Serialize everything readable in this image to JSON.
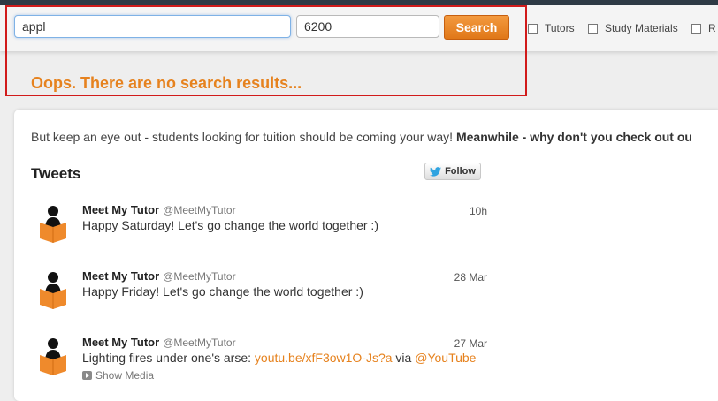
{
  "search": {
    "query_value": "appl",
    "postcode_value": "6200",
    "button_label": "Search",
    "filters": [
      {
        "label": "Tutors",
        "checked": false
      },
      {
        "label": "Study Materials",
        "checked": false
      },
      {
        "label": "R",
        "checked": false
      }
    ],
    "no_results": "Oops. There are no search results..."
  },
  "intro": {
    "text": "But keep an eye out - students looking for tuition should be coming your way! ",
    "bold": "Meanwhile - why don't you check out ou"
  },
  "tweets": {
    "title": "Tweets",
    "follow_label": "Follow",
    "items": [
      {
        "name": "Meet My Tutor",
        "handle": "@MeetMyTutor",
        "time": "10h",
        "text": "Happy Saturday! Let's go change the world together :)"
      },
      {
        "name": "Meet My Tutor",
        "handle": "@MeetMyTutor",
        "time": "28 Mar",
        "text": "Happy Friday! Let's go change the world together :)"
      },
      {
        "name": "Meet My Tutor",
        "handle": "@MeetMyTutor",
        "time": "27 Mar",
        "text_prefix": "Lighting fires under one's arse: ",
        "link": "youtu.be/xfF3ow1O-Js?a",
        "text_mid": " via ",
        "mention": "@YouTube",
        "show_media": "Show Media"
      }
    ]
  },
  "colors": {
    "accent": "#e6821e",
    "highlight": "#d11a1a",
    "header": "#2e3a45"
  }
}
